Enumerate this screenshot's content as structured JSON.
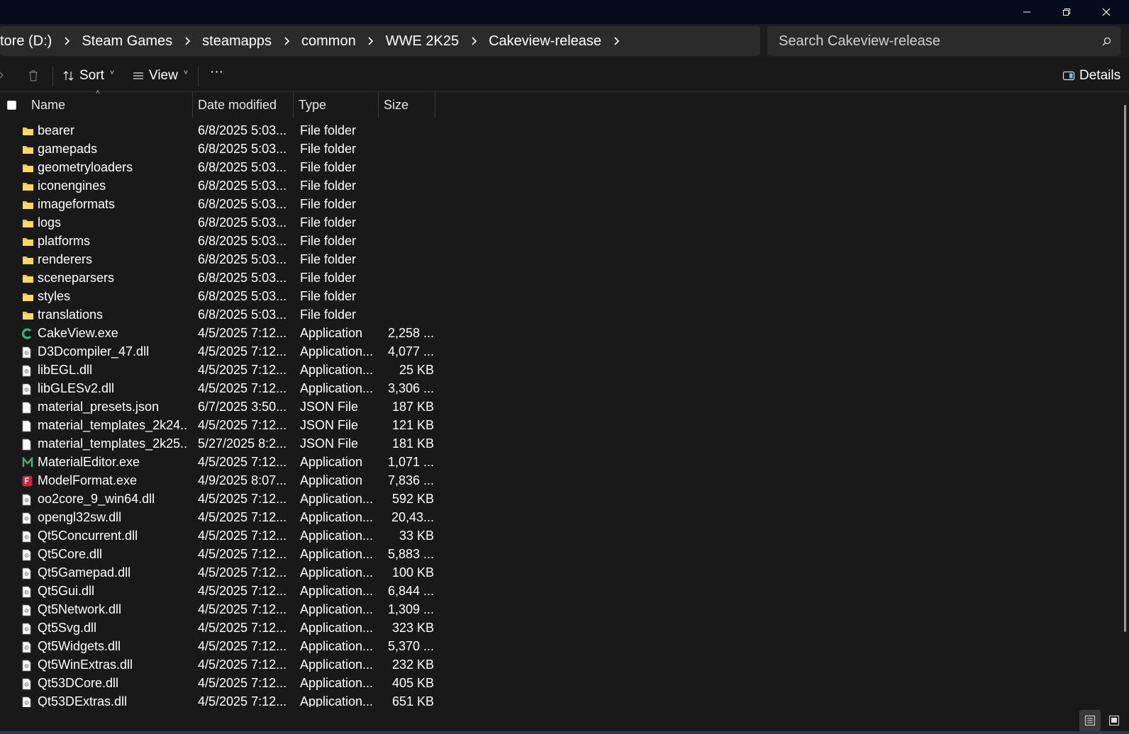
{
  "window": {
    "minimize_icon": "minimize-icon",
    "maximize_icon": "restore-icon",
    "close_icon": "close-icon"
  },
  "breadcrumb": [
    "tore (D:)",
    "Steam Games",
    "steamapps",
    "common",
    "WWE 2K25",
    "Cakeview-release"
  ],
  "search": {
    "placeholder": "Search Cakeview-release"
  },
  "toolbar": {
    "sort_label": "Sort",
    "view_label": "View",
    "more_label": "···",
    "details_label": "Details"
  },
  "columns": {
    "name": "Name",
    "date": "Date modified",
    "type": "Type",
    "size": "Size"
  },
  "files": [
    {
      "icon": "folder",
      "name": "bearer",
      "date": "6/8/2025 5:03...",
      "type": "File folder",
      "size": ""
    },
    {
      "icon": "folder",
      "name": "gamepads",
      "date": "6/8/2025 5:03...",
      "type": "File folder",
      "size": ""
    },
    {
      "icon": "folder",
      "name": "geometryloaders",
      "date": "6/8/2025 5:03...",
      "type": "File folder",
      "size": ""
    },
    {
      "icon": "folder",
      "name": "iconengines",
      "date": "6/8/2025 5:03...",
      "type": "File folder",
      "size": ""
    },
    {
      "icon": "folder",
      "name": "imageformats",
      "date": "6/8/2025 5:03...",
      "type": "File folder",
      "size": ""
    },
    {
      "icon": "folder",
      "name": "logs",
      "date": "6/8/2025 5:03...",
      "type": "File folder",
      "size": ""
    },
    {
      "icon": "folder",
      "name": "platforms",
      "date": "6/8/2025 5:03...",
      "type": "File folder",
      "size": ""
    },
    {
      "icon": "folder",
      "name": "renderers",
      "date": "6/8/2025 5:03...",
      "type": "File folder",
      "size": ""
    },
    {
      "icon": "folder",
      "name": "sceneparsers",
      "date": "6/8/2025 5:03...",
      "type": "File folder",
      "size": ""
    },
    {
      "icon": "folder",
      "name": "styles",
      "date": "6/8/2025 5:03...",
      "type": "File folder",
      "size": ""
    },
    {
      "icon": "folder",
      "name": "translations",
      "date": "6/8/2025 5:03...",
      "type": "File folder",
      "size": ""
    },
    {
      "icon": "cakeview",
      "name": "CakeView.exe",
      "date": "4/5/2025 7:12...",
      "type": "Application",
      "size": "2,258 ..."
    },
    {
      "icon": "dll",
      "name": "D3Dcompiler_47.dll",
      "date": "4/5/2025 7:12...",
      "type": "Application...",
      "size": "4,077 ..."
    },
    {
      "icon": "dll",
      "name": "libEGL.dll",
      "date": "4/5/2025 7:12...",
      "type": "Application...",
      "size": "25 KB"
    },
    {
      "icon": "dll",
      "name": "libGLESv2.dll",
      "date": "4/5/2025 7:12...",
      "type": "Application...",
      "size": "3,306 ..."
    },
    {
      "icon": "file",
      "name": "material_presets.json",
      "date": "6/7/2025 3:50...",
      "type": "JSON File",
      "size": "187 KB"
    },
    {
      "icon": "file",
      "name": "material_templates_2k24...",
      "date": "4/5/2025 7:12...",
      "type": "JSON File",
      "size": "121 KB"
    },
    {
      "icon": "file",
      "name": "material_templates_2k25...",
      "date": "5/27/2025 8:2...",
      "type": "JSON File",
      "size": "181 KB"
    },
    {
      "icon": "materialeditor",
      "name": "MaterialEditor.exe",
      "date": "4/5/2025 7:12...",
      "type": "Application",
      "size": "1,071 ..."
    },
    {
      "icon": "modelformat",
      "name": "ModelFormat.exe",
      "date": "4/9/2025 8:07...",
      "type": "Application",
      "size": "7,836 ..."
    },
    {
      "icon": "dll",
      "name": "oo2core_9_win64.dll",
      "date": "4/5/2025 7:12...",
      "type": "Application...",
      "size": "592 KB"
    },
    {
      "icon": "dll",
      "name": "opengl32sw.dll",
      "date": "4/5/2025 7:12...",
      "type": "Application...",
      "size": "20,43..."
    },
    {
      "icon": "dll",
      "name": "Qt5Concurrent.dll",
      "date": "4/5/2025 7:12...",
      "type": "Application...",
      "size": "33 KB"
    },
    {
      "icon": "dll",
      "name": "Qt5Core.dll",
      "date": "4/5/2025 7:12...",
      "type": "Application...",
      "size": "5,883 ..."
    },
    {
      "icon": "dll",
      "name": "Qt5Gamepad.dll",
      "date": "4/5/2025 7:12...",
      "type": "Application...",
      "size": "100 KB"
    },
    {
      "icon": "dll",
      "name": "Qt5Gui.dll",
      "date": "4/5/2025 7:12...",
      "type": "Application...",
      "size": "6,844 ..."
    },
    {
      "icon": "dll",
      "name": "Qt5Network.dll",
      "date": "4/5/2025 7:12...",
      "type": "Application...",
      "size": "1,309 ..."
    },
    {
      "icon": "dll",
      "name": "Qt5Svg.dll",
      "date": "4/5/2025 7:12...",
      "type": "Application...",
      "size": "323 KB"
    },
    {
      "icon": "dll",
      "name": "Qt5Widgets.dll",
      "date": "4/5/2025 7:12...",
      "type": "Application...",
      "size": "5,370 ..."
    },
    {
      "icon": "dll",
      "name": "Qt5WinExtras.dll",
      "date": "4/5/2025 7:12...",
      "type": "Application...",
      "size": "232 KB"
    },
    {
      "icon": "dll",
      "name": "Qt53DCore.dll",
      "date": "4/5/2025 7:12...",
      "type": "Application...",
      "size": "405 KB"
    },
    {
      "icon": "dll",
      "name": "Qt53DExtras.dll",
      "date": "4/5/2025 7:12...",
      "type": "Application...",
      "size": "651 KB"
    }
  ],
  "colors": {
    "folder": "#f8c640",
    "cakeview": "#3fae7a",
    "materialeditor": "#4caf7a",
    "modelformat": "#c8283c",
    "background": "#191919",
    "titlebar": "#050b1a"
  }
}
